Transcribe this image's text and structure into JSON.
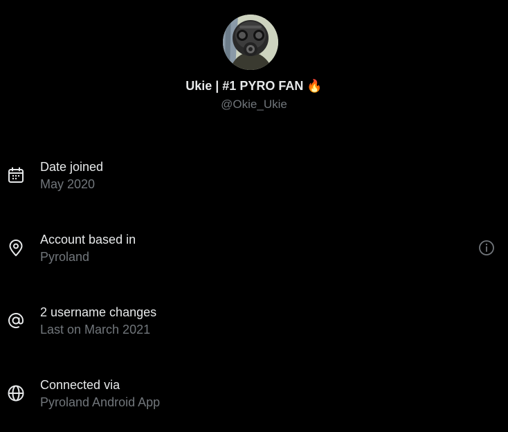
{
  "profile": {
    "display_name": "Ukie | #1 PYRO FAN 🔥",
    "handle": "@Okie_Ukie"
  },
  "rows": [
    {
      "icon": "calendar-icon",
      "title": "Date joined",
      "subtitle": "May 2020"
    },
    {
      "icon": "location-pin-icon",
      "title": "Account based in",
      "subtitle": "Pyroland"
    },
    {
      "icon": "at-sign-icon",
      "title": "2 username changes",
      "subtitle": "Last on March 2021"
    },
    {
      "icon": "globe-icon",
      "title": "Connected via",
      "subtitle": "Pyroland Android App"
    }
  ],
  "colors": {
    "background": "#000000",
    "primary_text": "#e7e9ea",
    "secondary_text": "#71767b"
  }
}
